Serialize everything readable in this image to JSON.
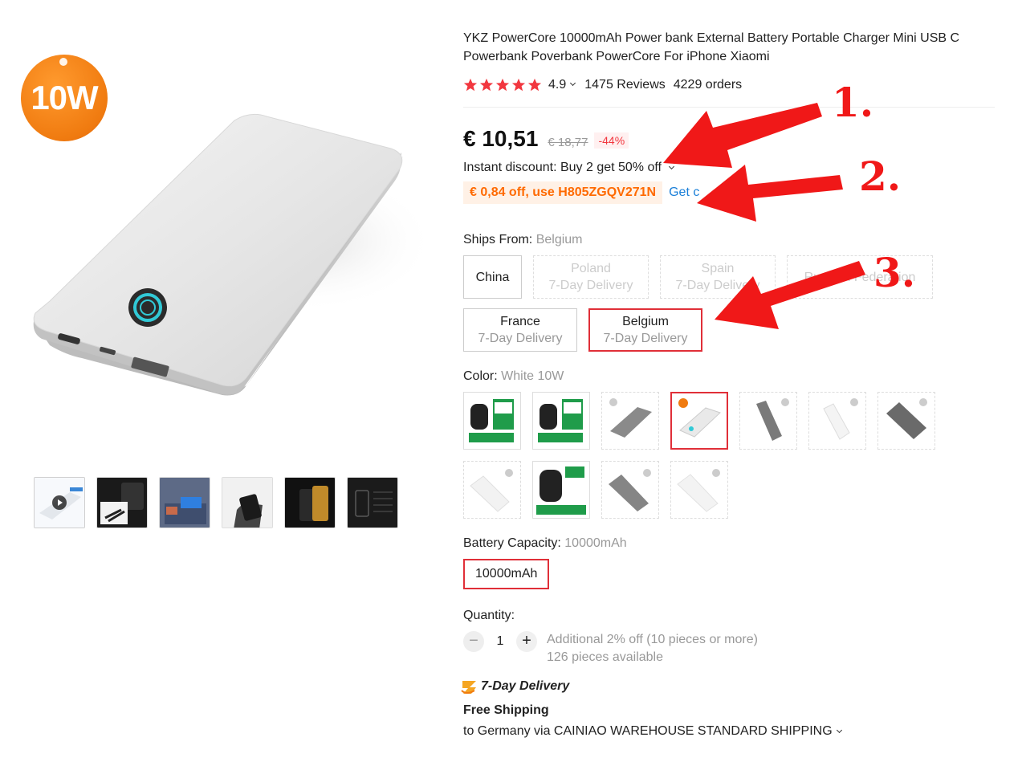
{
  "gallery": {
    "badge_text": "10W",
    "thumbnails": [
      {
        "name": "thumb-video",
        "has_play": true
      },
      {
        "name": "thumb-cables"
      },
      {
        "name": "thumb-safety"
      },
      {
        "name": "thumb-hand"
      },
      {
        "name": "thumb-phone"
      },
      {
        "name": "thumb-params"
      }
    ]
  },
  "product": {
    "title": "YKZ PowerCore 10000mAh Power bank External Battery Portable Charger Mini USB C Powerbank Poverbank PowerCore For iPhone Xiaomi",
    "rating": "4.9",
    "reviews": "1475 Reviews",
    "orders": "4229 orders",
    "price": "€ 10,51",
    "old_price": "€ 18,77",
    "discount": "-44%",
    "instant_discount": "Instant discount: Buy 2 get 50% off",
    "coupon": "€ 0,84 off, use H805ZGQV271N",
    "coupon_link": "Get c"
  },
  "ships_from": {
    "label": "Ships From:",
    "selected": "Belgium",
    "options": [
      {
        "name": "China",
        "sub": "",
        "state": "normal"
      },
      {
        "name": "Poland",
        "sub": "7-Day Delivery",
        "state": "disabled"
      },
      {
        "name": "Spain",
        "sub": "7-Day Delivery",
        "state": "disabled"
      },
      {
        "name": "Russian Federation",
        "sub": "",
        "state": "disabled"
      },
      {
        "name": "France",
        "sub": "7-Day Delivery",
        "state": "normal"
      },
      {
        "name": "Belgium",
        "sub": "7-Day Delivery",
        "state": "selected"
      }
    ]
  },
  "color": {
    "label": "Color:",
    "selected": "White 10W"
  },
  "battery": {
    "label": "Battery Capacity:",
    "selected": "10000mAh",
    "option": "10000mAh"
  },
  "quantity": {
    "label": "Quantity:",
    "value": "1",
    "minus": "−",
    "plus": "+",
    "bulk_note": "Additional 2% off (10 pieces or more)",
    "available": "126 pieces available"
  },
  "delivery": {
    "badge": "7-Day Delivery",
    "free_shipping": "Free Shipping",
    "route": "to Germany via CAINIAO WAREHOUSE STANDARD SHIPPING"
  },
  "annotations": [
    "1.",
    "2.",
    "3."
  ],
  "colors": {
    "accent_red": "#e02f38",
    "star_red": "#f2373f",
    "coupon_orange": "#ff6a00",
    "link_blue": "#1a7fd8",
    "arrow_red": "#f01818"
  }
}
